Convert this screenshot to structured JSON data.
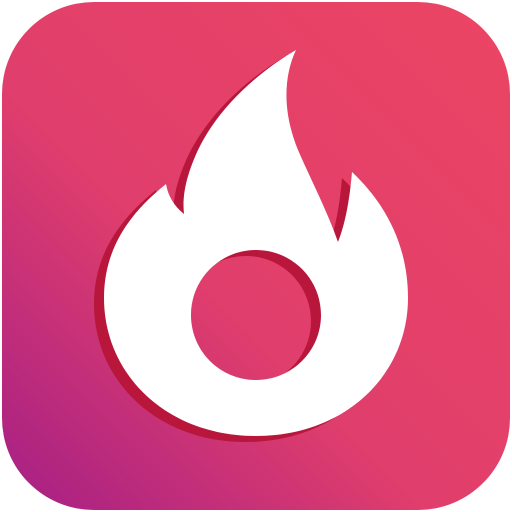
{
  "icon": {
    "name": "flame-app-icon",
    "symbol": "flame-icon",
    "colors": {
      "gradient_top_right": "#EC4563",
      "gradient_mid": "#E03E6C",
      "gradient_bottom_left": "#A51F86",
      "flame_fill": "#FFFFFF",
      "flame_shadow": "#B9163B"
    }
  }
}
